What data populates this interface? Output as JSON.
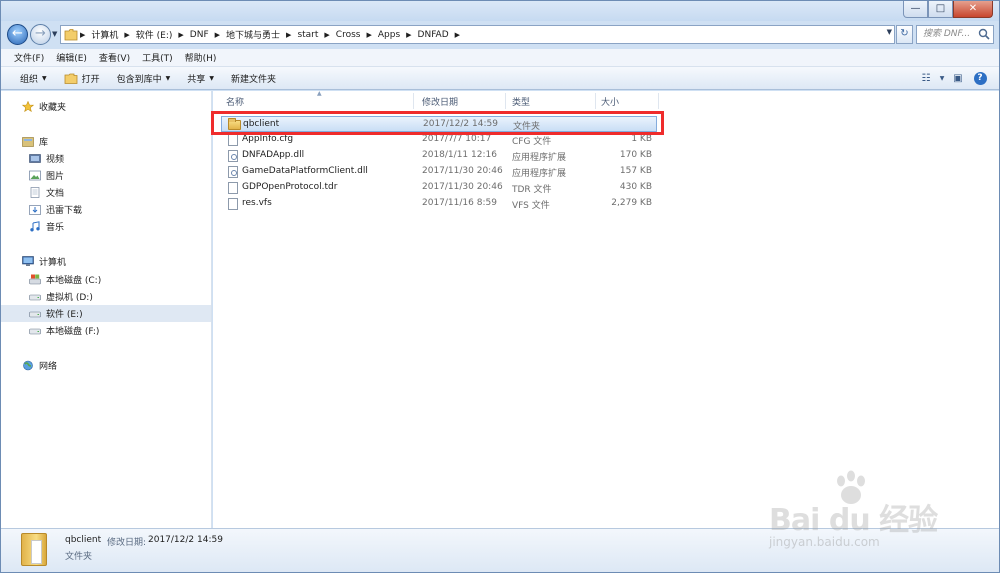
{
  "window": {
    "controls": {
      "minimize": "—",
      "maximize": "□",
      "close": "✕"
    }
  },
  "address": {
    "crumbs": [
      "计算机",
      "软件 (E:)",
      "DNF",
      "地下城与勇士",
      "start",
      "Cross",
      "Apps",
      "DNFAD"
    ],
    "refresh_icon": "refresh-icon",
    "search_placeholder": "搜索 DNF..."
  },
  "menubar": {
    "items": [
      "文件(F)",
      "编辑(E)",
      "查看(V)",
      "工具(T)",
      "帮助(H)"
    ]
  },
  "toolbar": {
    "organize": "组织",
    "open": "打开",
    "include_in_library": "包含到库中",
    "share": "共享",
    "new_folder": "新建文件夹"
  },
  "navpane": {
    "favorites": "收藏夹",
    "libraries": "库",
    "lib_items": [
      "视频",
      "图片",
      "文档",
      "迅雷下载",
      "音乐"
    ],
    "computer": "计算机",
    "drives": [
      "本地磁盘 (C:)",
      "虚拟机 (D:)",
      "软件 (E:)",
      "本地磁盘 (F:)"
    ],
    "selected_drive": "软件 (E:)",
    "network": "网络"
  },
  "columns": {
    "name": "名称",
    "date": "修改日期",
    "type": "类型",
    "size": "大小"
  },
  "files": [
    {
      "name": "qbclient",
      "date": "2017/12/2 14:59",
      "type": "文件夹",
      "size": "",
      "kind": "folder"
    },
    {
      "name": "AppInfo.cfg",
      "date": "2017/7/7 10:17",
      "type": "CFG 文件",
      "size": "1 KB",
      "kind": "file"
    },
    {
      "name": "DNFADApp.dll",
      "date": "2018/1/11 12:16",
      "type": "应用程序扩展",
      "size": "170 KB",
      "kind": "dll"
    },
    {
      "name": "GameDataPlatformClient.dll",
      "date": "2017/11/30 20:46",
      "type": "应用程序扩展",
      "size": "157 KB",
      "kind": "dll"
    },
    {
      "name": "GDPOpenProtocol.tdr",
      "date": "2017/11/30 20:46",
      "type": "TDR 文件",
      "size": "430 KB",
      "kind": "file"
    },
    {
      "name": "res.vfs",
      "date": "2017/11/16 8:59",
      "type": "VFS 文件",
      "size": "2,279 KB",
      "kind": "file"
    }
  ],
  "details": {
    "name": "qbclient",
    "modified_label": "修改日期:",
    "modified_value": "2017/12/2 14:59",
    "type": "文件夹"
  },
  "watermark": {
    "text": "Bai du 经验",
    "url": "jingyan.baidu.com"
  },
  "colors": {
    "highlight": "#ef2c2c",
    "selection": "#c9def5",
    "accent": "#2d6fc4"
  }
}
